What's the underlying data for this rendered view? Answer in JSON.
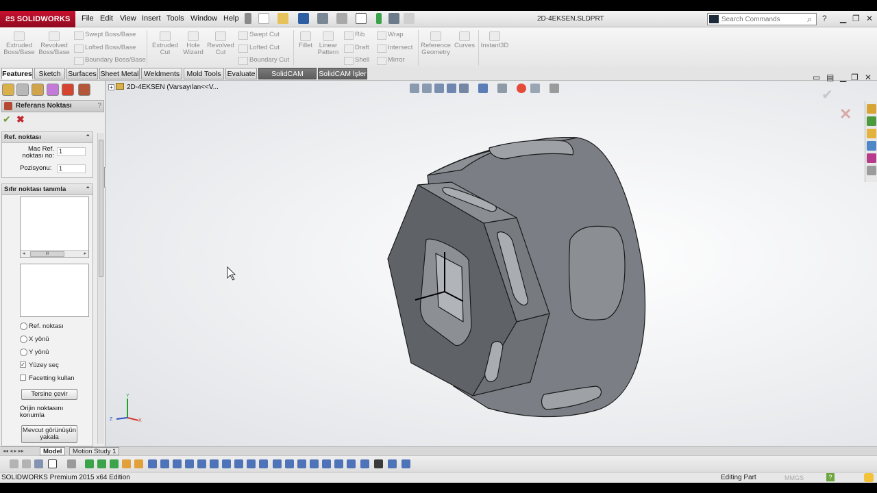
{
  "app": {
    "logo_text": "SOLIDWORKS",
    "document_title": "2D-4EKSEN.SLDPRT",
    "menu": [
      "File",
      "Edit",
      "View",
      "Insert",
      "Tools",
      "Window",
      "Help"
    ],
    "search_placeholder": "Search Commands",
    "search_icon": "magnifier-icon",
    "brand_color": "#c8102e"
  },
  "command_manager": {
    "large_buttons": [
      {
        "label": "Extruded Boss/Base"
      },
      {
        "label": "Revolved Boss/Base"
      },
      {
        "label": "Extruded Cut"
      },
      {
        "label": "Hole Wizard"
      },
      {
        "label": "Revolved Cut"
      },
      {
        "label": "Fillet"
      },
      {
        "label": "Linear Pattern"
      },
      {
        "label": "Reference Geometry"
      },
      {
        "label": "Curves"
      },
      {
        "label": "Instant3D"
      }
    ],
    "small_buttons": [
      {
        "label": "Swept Boss/Base"
      },
      {
        "label": "Lofted Boss/Base"
      },
      {
        "label": "Boundary Boss/Base"
      },
      {
        "label": "Swept Cut"
      },
      {
        "label": "Lofted Cut"
      },
      {
        "label": "Boundary Cut"
      },
      {
        "label": "Rib"
      },
      {
        "label": "Draft"
      },
      {
        "label": "Shell"
      },
      {
        "label": "Wrap"
      },
      {
        "label": "Intersect"
      },
      {
        "label": "Mirror"
      }
    ]
  },
  "tabs": [
    "Features",
    "Sketch",
    "Surfaces",
    "Sheet Metal",
    "Weldments",
    "Mold Tools",
    "Evaluate",
    "SolidCAM Parçası",
    "SolidCAM İşler"
  ],
  "active_tab": "Features",
  "feature_tree": {
    "root_label": "2D-4EKSEN  (Varsayılan<<V..."
  },
  "property_manager": {
    "title": "Referans Noktası",
    "help": "?",
    "ref_group": {
      "title": "Ref. noktası",
      "mac_ref_label": "Mac Ref. noktası no:",
      "mac_ref_value": "1",
      "position_label": "Pozisyonu:",
      "position_value": "1"
    },
    "zero_group": {
      "title": "Sıfır noktası tanımla",
      "scroll_label": "III",
      "radios": [
        "Ref. noktası",
        "X yönü",
        "Y yönü"
      ],
      "checks": [
        {
          "label": "Yüzey seç",
          "checked": true
        },
        {
          "label": "Facetting kullan",
          "checked": false
        }
      ],
      "reverse_button": "Tersine çevir",
      "origin_label": "Orijin noktasını konumla",
      "capture_button": "Mevcut görünüşün yakala"
    }
  },
  "bottom_tabs": [
    "Model",
    "Motion Study 1"
  ],
  "status_bar": {
    "edition": "SOLIDWORKS Premium 2015 x64 Edition",
    "mode": "Editing Part",
    "units": "MMGS"
  },
  "triad_labels": {
    "x": "X",
    "y": "Y",
    "z": "Z"
  },
  "part_color": "#6f7378"
}
